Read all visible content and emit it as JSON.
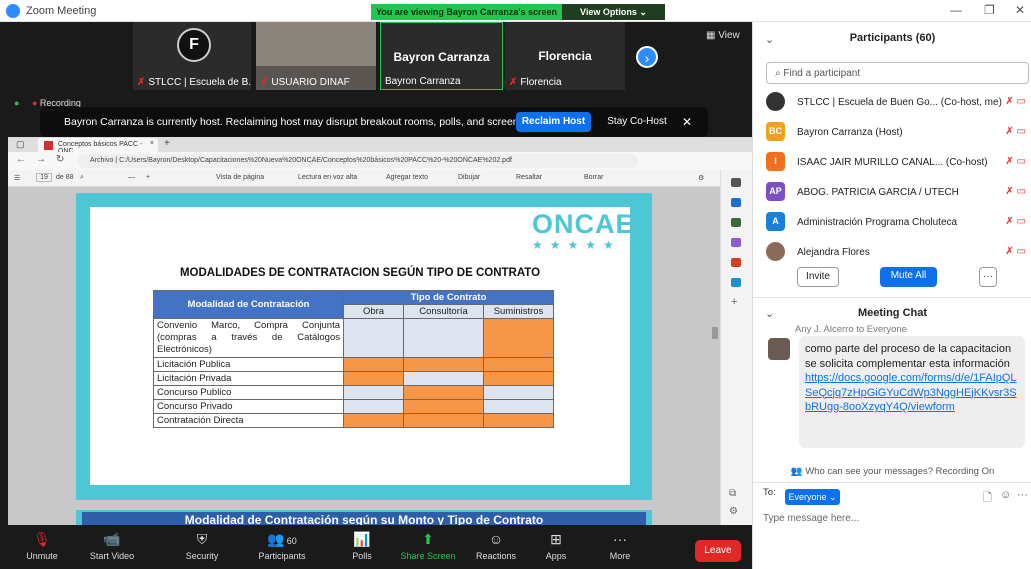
{
  "window": {
    "title": "Zoom Meeting",
    "viewing_banner": "You are viewing Bayron Carranza's screen",
    "view_options": "View Options"
  },
  "gallery": {
    "tiles": [
      {
        "label": "STLCC | Escuela de B..."
      },
      {
        "label": "USUARIO DINAF"
      },
      {
        "label": "Bayron Carranza",
        "big": "Bayron Carranza"
      },
      {
        "label": "Florencia",
        "big": "Florencia"
      }
    ],
    "view_label": "View",
    "recording_label": "Recording"
  },
  "host_bar": {
    "message": "Bayron Carranza is currently host. Reclaiming host may disrupt breakout rooms, polls, and screen share",
    "reclaim": "Reclaim Host",
    "stay": "Stay Co-Host"
  },
  "browser": {
    "tab_label": "Conceptos básicos PACC - ONC...",
    "url_prefix": "Archivo",
    "url": "C:/Users/Bayron/Desktop/Capacitaciones%20Nueva%20ONCAE/Conceptos%20básicos%20PACC%20-%20ONCAE%202.pdf",
    "page_num": "19",
    "page_total": "de 88",
    "tools": [
      "Vista de página",
      "Lectura en voz alta",
      "Agregar texto",
      "Dibujar",
      "Resaltar",
      "Borrar"
    ]
  },
  "slide": {
    "logo": "ONCAE",
    "title": "MODALIDADES DE CONTRATACION SEGÚN TIPO DE CONTRATO",
    "header_modalidad": "Modalidad de Contratación",
    "header_tipo": "Tipo de Contrato",
    "subheaders": [
      "Obra",
      "Consultoría",
      "Suministros"
    ],
    "rows": [
      {
        "label": "Convenio Marco, Compra Conjunta (compras a través de Catálogos Electrónicos)",
        "cells": [
          "b",
          "b",
          "o"
        ]
      },
      {
        "label": "Licitación Publica",
        "cells": [
          "o",
          "o",
          "o"
        ]
      },
      {
        "label": "Licitación Privada",
        "cells": [
          "o",
          "b",
          "o"
        ]
      },
      {
        "label": "Concurso Publico",
        "cells": [
          "b",
          "o",
          "b"
        ]
      },
      {
        "label": "Concurso Privado",
        "cells": [
          "b",
          "o",
          "b"
        ]
      },
      {
        "label": "Contratación Directa",
        "cells": [
          "o",
          "o",
          "o"
        ]
      }
    ],
    "next_title": "Modalidad de Contratación según su Monto y Tipo de Contrato",
    "colors": {
      "orange": "#f79646",
      "blue": "#dde3ef",
      "header": "#4472c4",
      "frame": "#4dc6d6"
    }
  },
  "toolbar": {
    "items": [
      {
        "label": "Unmute",
        "icon": "mic-muted-icon"
      },
      {
        "label": "Start Video",
        "icon": "camera-off-icon"
      },
      {
        "label": "Security",
        "icon": "shield-icon"
      },
      {
        "label": "Participants",
        "icon": "participants-icon",
        "badge": "60"
      },
      {
        "label": "Polls",
        "icon": "polls-icon"
      },
      {
        "label": "Share Screen",
        "icon": "share-screen-icon"
      },
      {
        "label": "Reactions",
        "icon": "reactions-icon"
      },
      {
        "label": "Apps",
        "icon": "apps-icon"
      },
      {
        "label": "More",
        "icon": "more-icon"
      }
    ],
    "leave": "Leave"
  },
  "participants": {
    "header": "Participants (60)",
    "search_placeholder": "Find a participant",
    "list": [
      {
        "initials": "",
        "name": "STLCC | Escuela de Buen Go... (Co-host, me)",
        "color": "#333333"
      },
      {
        "initials": "BC",
        "name": "Bayron Carranza (Host)",
        "color": "#f0a020"
      },
      {
        "initials": "I",
        "name": "ISAAC JAIR MURILLO CANAL... (Co-host)",
        "color": "#f07020"
      },
      {
        "initials": "AP",
        "name": "ABOG. PATRICIA GARCIA / UTECH",
        "color": "#7b4fc0"
      },
      {
        "initials": "A",
        "name": "Administración Programa Choluteca",
        "color": "#1a7fd6"
      },
      {
        "initials": "",
        "name": "Alejandra Flores",
        "color": "#8a6a5a"
      }
    ],
    "invite": "Invite",
    "mute_all": "Mute All"
  },
  "chat": {
    "header": "Meeting Chat",
    "sender": "Any J. Alcerro to Everyone",
    "message": "como parte del proceso de la capacitacion se solicita complementar esta información",
    "link": "https://docs.google.com/forms/d/e/1FAIpQLSeQcjq7zHpGiGYuCdWp3NggHEjKKvsr3SbRUgg-8ooXzyqY4Q/viewform",
    "who_can_see": "Who can see your messages? Recording On",
    "to_label": "To:",
    "to_value": "Everyone",
    "placeholder": "Type message here..."
  }
}
